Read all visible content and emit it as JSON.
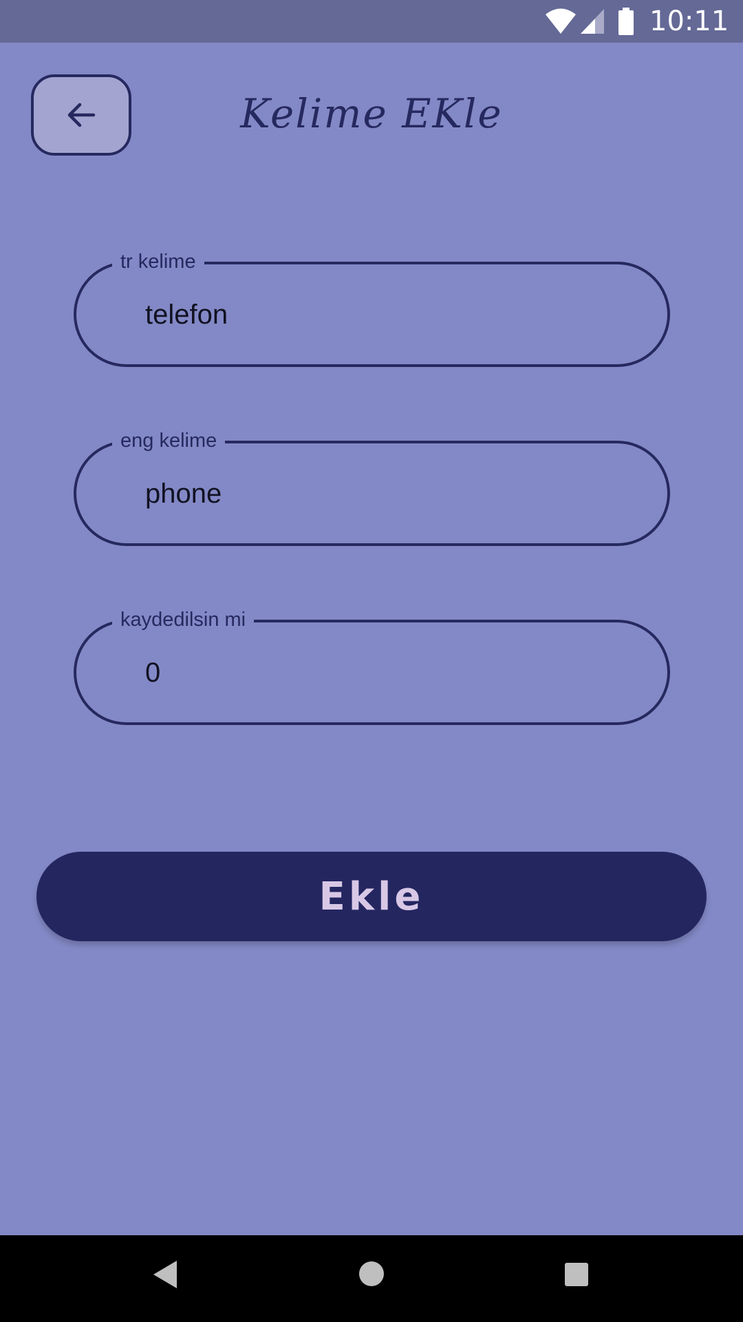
{
  "status_bar": {
    "time": "10:11",
    "icons": [
      "wifi-icon",
      "cell-signal-icon",
      "battery-icon"
    ]
  },
  "header": {
    "back_icon": "arrow-left-icon",
    "title": "Kelime EKle"
  },
  "form": {
    "fields": [
      {
        "label": "tr kelime",
        "value": "telefon"
      },
      {
        "label": "eng kelime",
        "value": "phone"
      },
      {
        "label": "kaydedilsin mi",
        "value": "0"
      }
    ],
    "submit_label": "Ekle"
  },
  "nav_bar": {
    "icons": [
      "nav-back-icon",
      "nav-home-icon",
      "nav-recents-icon"
    ]
  },
  "colors": {
    "background": "#8389c6",
    "status_bar": "#646996",
    "accent": "#26295f",
    "button": "#242660",
    "button_text": "#d8c8e6",
    "back_button_fill": "#a3a4d0"
  }
}
